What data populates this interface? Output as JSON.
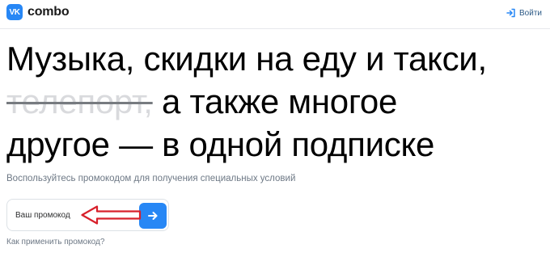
{
  "header": {
    "logo_mark": "VK",
    "logo_text": "combo",
    "login_label": "Войти",
    "login_icon": "sign-in-icon"
  },
  "headline": {
    "line1": "Музыка, скидки на еду и такси,",
    "struck": "телепорт,",
    "line2_rest": " а также многое",
    "line3": "другое — в одной подписке"
  },
  "subtitle": "Воспользуйтесь промокодом для получения специальных условий",
  "promo": {
    "placeholder": "Ваш промокод",
    "value": "",
    "submit_icon": "arrow-right-icon"
  },
  "annotation": {
    "icon": "red-arrow-left-icon"
  },
  "help_link": "Как применить промокод?",
  "colors": {
    "accent": "#2787f5",
    "secondary_text": "#6d7885",
    "annotation_red": "#d8202b",
    "struck_text": "#d9dadd"
  }
}
